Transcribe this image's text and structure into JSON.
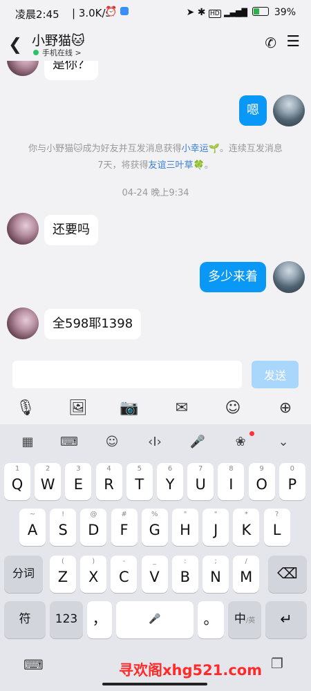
{
  "status_bar": {
    "time": "凌晨2:45",
    "network_speed": "| 3.0K/s",
    "battery_percent": "39%",
    "icons": [
      "alarm-icon",
      "app-notification-icon",
      "location-icon",
      "bluetooth-icon",
      "hd-icon",
      "signal-icon",
      "battery-icon"
    ]
  },
  "header": {
    "contact_name": "小野猫🐱",
    "status": "手机在线 >",
    "status_color": "#2ec36b"
  },
  "chat": {
    "messages": [
      {
        "side": "in",
        "text": "是你？"
      },
      {
        "side": "out",
        "text": "嗯"
      },
      {
        "side": "system",
        "pre": "你与小野猫🐱成为好友并互发消息获得",
        "link1": "小幸运🌱",
        "mid": "。连续互发消息7天，将获得",
        "link2": "友谊三叶草🍀",
        "post": "。"
      },
      {
        "side": "time",
        "text": "04-24 晚上9:34"
      },
      {
        "side": "in",
        "text": "还要吗"
      },
      {
        "side": "out",
        "text": "多少来着"
      },
      {
        "side": "in",
        "text": "全598耶1398"
      }
    ],
    "bubble_out_color": "#0a98f7"
  },
  "input": {
    "value": "",
    "placeholder": "",
    "send_label": "发送"
  },
  "toolbar": [
    "microphone-icon",
    "image-icon",
    "camera-icon",
    "red-packet-icon",
    "emoji-icon",
    "plus-icon"
  ],
  "keyboard_toolbar": [
    "grid-apps-icon",
    "keyboard-icon",
    "emoji-icon",
    "cursor-icon",
    "mic-icon",
    "sticker-icon",
    "collapse-icon"
  ],
  "keyboard": {
    "row1": [
      {
        "k": "Q",
        "a": "1"
      },
      {
        "k": "W",
        "a": "2"
      },
      {
        "k": "E",
        "a": "3"
      },
      {
        "k": "R",
        "a": "4"
      },
      {
        "k": "T",
        "a": "5"
      },
      {
        "k": "Y",
        "a": "6"
      },
      {
        "k": "U",
        "a": "7"
      },
      {
        "k": "I",
        "a": "8"
      },
      {
        "k": "O",
        "a": "9"
      },
      {
        "k": "P",
        "a": "0"
      }
    ],
    "row2": [
      {
        "k": "A",
        "a": "~"
      },
      {
        "k": "S",
        "a": "!"
      },
      {
        "k": "D",
        "a": "@"
      },
      {
        "k": "F",
        "a": "#"
      },
      {
        "k": "G",
        "a": "%"
      },
      {
        "k": "H",
        "a": "\""
      },
      {
        "k": "J",
        "a": "\""
      },
      {
        "k": "K",
        "a": "*"
      },
      {
        "k": "L",
        "a": "?"
      }
    ],
    "row3": [
      {
        "k": "Z",
        "a": "("
      },
      {
        "k": "X",
        "a": ")"
      },
      {
        "k": "C",
        "a": "-"
      },
      {
        "k": "V",
        "a": "_"
      },
      {
        "k": "B",
        "a": ":"
      },
      {
        "k": "N",
        "a": ";"
      },
      {
        "k": "M",
        "a": "/"
      }
    ],
    "fenci": "分词",
    "backspace": "⌫",
    "symbol": "符",
    "num": "123",
    "comma": "，",
    "period": "。",
    "lang": "中",
    "lang_sub": "/英",
    "enter": "↵"
  },
  "watermark": "寻欢阁xhg521.com"
}
